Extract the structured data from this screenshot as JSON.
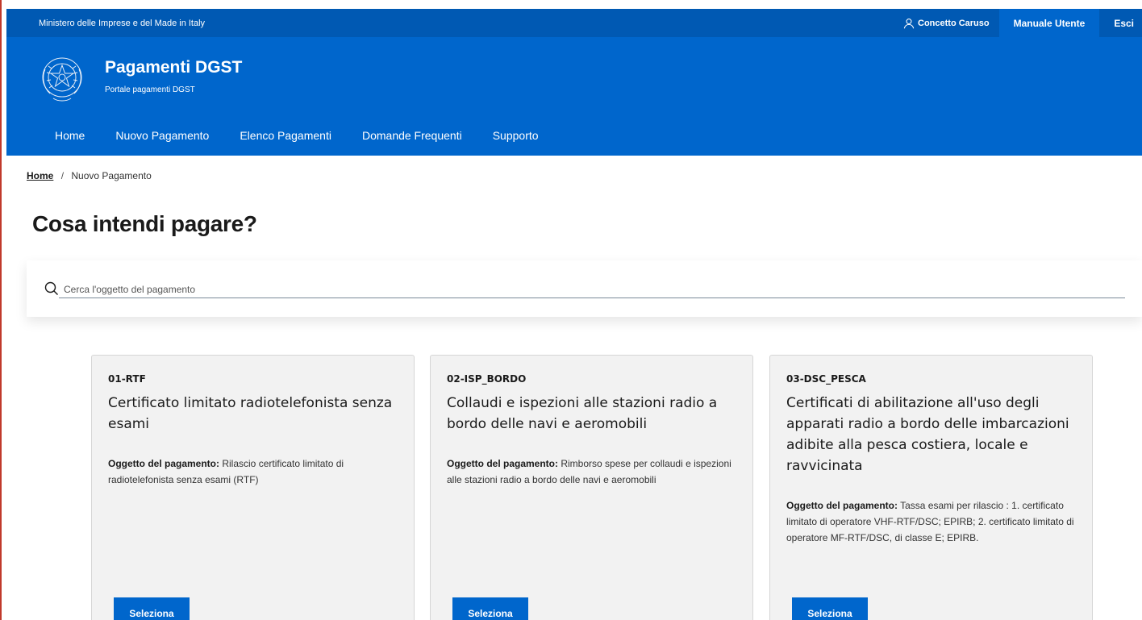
{
  "header": {
    "organization": "Ministero delle Imprese e del Made in Italy",
    "user_name": "Concetto Caruso",
    "manual_label": "Manuale Utente",
    "logout_label": "Esci"
  },
  "brand": {
    "title": "Pagamenti DGST",
    "subtitle": "Portale pagamenti DGST"
  },
  "nav": {
    "items": [
      "Home",
      "Nuovo Pagamento",
      "Elenco Pagamenti",
      "Domande Frequenti",
      "Supporto"
    ]
  },
  "breadcrumb": {
    "home": "Home",
    "separator": "/",
    "current": "Nuovo Pagamento"
  },
  "page_title": "Cosa intendi pagare?",
  "search": {
    "placeholder": "Cerca l'oggetto del pagamento",
    "value": ""
  },
  "cards": [
    {
      "code": "01-RTF",
      "title": "Certificato limitato radiotelefonista senza esami",
      "desc_label": "Oggetto del pagamento:",
      "desc_text": "Rilascio certificato limitato di radiotelefonista senza esami (RTF)",
      "button": "Seleziona"
    },
    {
      "code": "02-ISP_BORDO",
      "title": "Collaudi e ispezioni alle stazioni radio a bordo delle navi e aeromobili",
      "desc_label": "Oggetto del pagamento:",
      "desc_text": "Rimborso spese per collaudi e ispezioni alle stazioni radio a bordo delle navi e aeromobili",
      "button": "Seleziona"
    },
    {
      "code": "03-DSC_PESCA",
      "title": "Certificati di abilitazione all'uso degli apparati radio a bordo delle imbarcazioni adibite alla pesca costiera, locale e ravvicinata",
      "desc_label": "Oggetto del pagamento:",
      "desc_text": "Tassa esami per rilascio : 1. certificato limitato di operatore VHF-RTF/DSC; EPIRB; 2. certificato limitato di operatore MF-RTF/DSC, di classe E; EPIRB.",
      "button": "Seleziona"
    }
  ],
  "colors": {
    "slim_header": "#0059b3",
    "center_header": "#0066cc",
    "button": "#0066cc",
    "card_bg": "#f2f2f2"
  },
  "icons": {
    "user": "user-icon",
    "search": "search-icon",
    "emblem": "emblem-icon"
  }
}
